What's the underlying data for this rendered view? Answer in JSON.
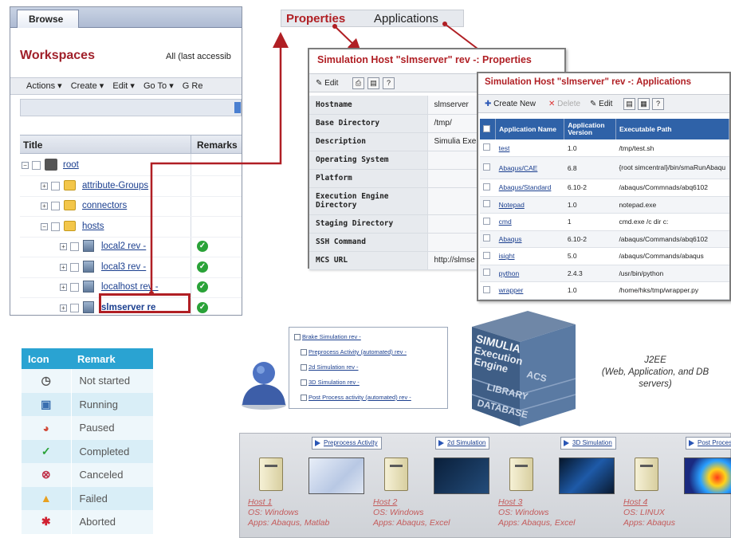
{
  "workspace": {
    "tab": "Browse",
    "heading": "Workspaces",
    "filter": "All (last accessib",
    "menu": [
      "Actions ▾",
      "Create ▾",
      "Edit ▾",
      "Go To ▾",
      "G Re"
    ],
    "columns": {
      "title": "Title",
      "remarks": "Remarks"
    },
    "tree": [
      {
        "label": "root",
        "level": 0,
        "exp": "−",
        "icon": "root"
      },
      {
        "label": "attribute-Groups",
        "level": 1,
        "exp": "+",
        "icon": "folder"
      },
      {
        "label": "connectors",
        "level": 1,
        "exp": "+",
        "icon": "folder"
      },
      {
        "label": "hosts",
        "level": 1,
        "exp": "−",
        "icon": "folder"
      },
      {
        "label": "local2 rev -",
        "level": 2,
        "exp": "+",
        "icon": "host",
        "ok": true
      },
      {
        "label": "local3 rev -",
        "level": 2,
        "exp": "+",
        "icon": "host",
        "ok": true
      },
      {
        "label": "localhost rev -",
        "level": 2,
        "exp": "+",
        "icon": "host",
        "ok": true
      },
      {
        "label": "slmserver re",
        "level": 2,
        "exp": "+",
        "icon": "host",
        "ok": true,
        "bold": true
      }
    ]
  },
  "top_tabs": {
    "properties": "Properties",
    "applications": "Applications"
  },
  "properties": {
    "title": "Simulation Host \"slmserver\" rev -: Properties",
    "toolbar": {
      "edit": "Edit"
    },
    "rows": [
      {
        "key": "Hostname",
        "value": "slmserver"
      },
      {
        "key": "Base Directory",
        "value": "/tmp/"
      },
      {
        "key": "Description",
        "value": "Simulia Exe"
      },
      {
        "key": "Operating System",
        "value": ""
      },
      {
        "key": "Platform",
        "value": ""
      },
      {
        "key": "Execution Engine Directory",
        "value": ""
      },
      {
        "key": "Staging Directory",
        "value": ""
      },
      {
        "key": "SSH Command",
        "value": ""
      },
      {
        "key": "MCS URL",
        "value": "http://slmse"
      }
    ]
  },
  "applications": {
    "title": "Simulation Host \"slmserver\" rev -: Applications",
    "toolbar": {
      "create": "Create New",
      "delete": "Delete",
      "edit": "Edit"
    },
    "headers": [
      "Application Name",
      "Application Version",
      "Executable Path"
    ],
    "rows": [
      {
        "name": "test",
        "version": "1.0",
        "path": "/tmp/test.sh"
      },
      {
        "name": "Abaqus/CAE",
        "version": "6.8",
        "path": "{root simcentral}/bin/smaRunAbaqu"
      },
      {
        "name": "Abaqus/Standard",
        "version": "6.10-2",
        "path": "/abaqus/Commnads/abq6102"
      },
      {
        "name": "Notepad",
        "version": "1.0",
        "path": "notepad.exe"
      },
      {
        "name": "cmd",
        "version": "1",
        "path": "cmd.exe /c dir c:"
      },
      {
        "name": "Abaqus",
        "version": "6.10-2",
        "path": "/abaqus/Commands/abq6102"
      },
      {
        "name": "isight",
        "version": "5.0",
        "path": "/abaqus/Commands/abaqus"
      },
      {
        "name": "python",
        "version": "2.4.3",
        "path": "/usr/bin/python"
      },
      {
        "name": "wrapper",
        "version": "1.0",
        "path": "/home/hks/tmp/wrapper.py"
      }
    ]
  },
  "legend": {
    "header_icon": "Icon",
    "header_remark": "Remark",
    "rows": [
      {
        "remark": "Not started",
        "icon": "clock-icon",
        "color": "#555555"
      },
      {
        "remark": "Running",
        "icon": "running-icon",
        "color": "#3a6fb0"
      },
      {
        "remark": "Paused",
        "icon": "paused-icon",
        "color": "#d24b3a"
      },
      {
        "remark": "Completed",
        "icon": "check-icon",
        "color": "#2aa238"
      },
      {
        "remark": "Canceled",
        "icon": "cancel-icon",
        "color": "#c0324a"
      },
      {
        "remark": "Failed",
        "icon": "warning-icon",
        "color": "#e8a020"
      },
      {
        "remark": "Aborted",
        "icon": "aborted-icon",
        "color": "#d02030"
      }
    ]
  },
  "process": {
    "items": [
      "Brake Simulation rev -",
      "Preprocess Activity (automated) rev -",
      "2d Simulation rev -",
      "3D Simulation rev -",
      "Post Process activity (automated) rev -"
    ]
  },
  "cube": {
    "lines": [
      "SIMULIA",
      "Execution",
      "Engine"
    ],
    "acs": "ACS",
    "library": "LIBRARY",
    "database": "DATABASE"
  },
  "j2ee": {
    "title": "J2EE",
    "desc": "(Web, Application, and DB servers)"
  },
  "hosts": [
    {
      "activity": "Preprocess Activity",
      "name": "Host 1",
      "os": "OS: Windows",
      "apps": "Apps: Abaqus, Matlab"
    },
    {
      "activity": "2d Simulation",
      "name": "Host 2",
      "os": "OS: Windows",
      "apps": "Apps: Abaqus, Excel"
    },
    {
      "activity": "3D Simulation",
      "name": "Host 3",
      "os": "OS: Windows",
      "apps": "Apps: Abaqus, Excel"
    },
    {
      "activity": "Post Process activity",
      "name": "Host 4",
      "os": "OS: LINUX",
      "apps": "Apps: Abaqus"
    }
  ],
  "colors": {
    "accent_red": "#b01f24",
    "link_blue": "#1b3f8f",
    "legend_header": "#2aa3d2",
    "app_header": "#2f62a8"
  }
}
